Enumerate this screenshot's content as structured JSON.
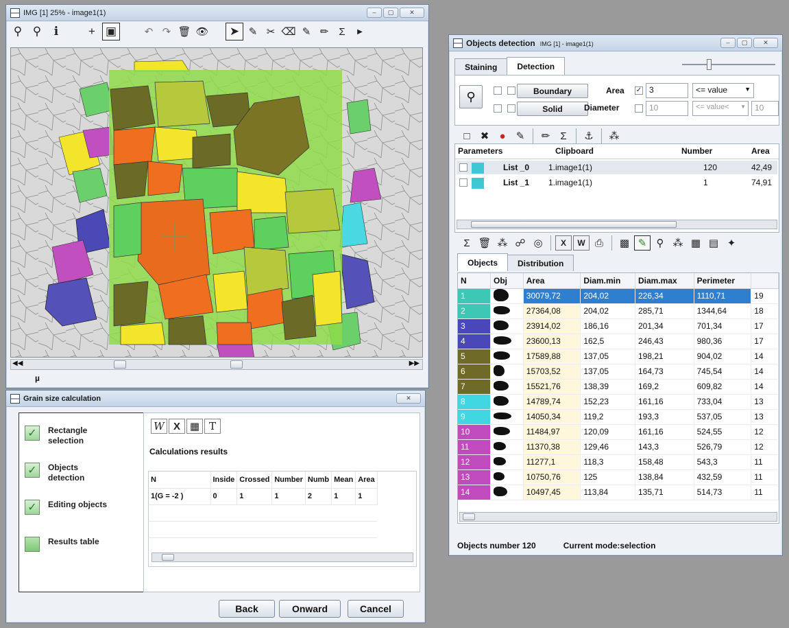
{
  "image_window": {
    "title": "IMG [1] 25% - image1(1)",
    "window_controls": [
      "–",
      "▢",
      "✕"
    ],
    "status_unit": "µ"
  },
  "grain_window": {
    "title": "Grain size calculation",
    "close": "✕",
    "steps": [
      {
        "label": "Rectangle selection",
        "done": true
      },
      {
        "label": "Objects detection",
        "done": true
      },
      {
        "label": "Editing objects",
        "done": true
      },
      {
        "label": "Results table",
        "done": false
      }
    ],
    "calc_title": "Calculations results",
    "table": {
      "headers": [
        "N",
        "Inside",
        "Crossed",
        "Number",
        "Numb",
        "Mean",
        "Area"
      ],
      "rows": [
        [
          "1(G = -2 )",
          "0",
          "1",
          "1",
          "2",
          "1",
          "1"
        ]
      ]
    },
    "buttons": {
      "back": "Back",
      "onward": "Onward",
      "cancel": "Cancel"
    }
  },
  "objects_window": {
    "title": "Objects detection",
    "title_sub": "IMG [1] - image1(1)",
    "tabs": [
      "Staining",
      "Detection"
    ],
    "detection": {
      "boundary_label": "Boundary",
      "solid_label": "Solid",
      "area_label": "Area",
      "area_value": "3",
      "area_mode": "<= value",
      "diameter_label": "Diameter",
      "diameter_value": "10",
      "diameter_mode": "<= value<",
      "diameter_value2": "10"
    },
    "list_headers": [
      "Parameters",
      "Clipboard",
      "Number",
      "Area"
    ],
    "list_rows": [
      {
        "name": "List _0",
        "clip": "1.image1(1)",
        "number": "120",
        "area": "42,49"
      },
      {
        "name": "List _1",
        "clip": "1.image1(1)",
        "number": "1",
        "area": "74,91"
      }
    ],
    "obj_tabs": [
      "Objects",
      "Distribution"
    ],
    "obj_headers": [
      "N",
      "Obj",
      "Area",
      "Diam.min",
      "Diam.max",
      "Perimeter",
      ""
    ],
    "obj_rows": [
      {
        "n": "1",
        "color": "#3dc7b5",
        "area": "30079,72",
        "dmin": "204,02",
        "dmax": "226,34",
        "per": "1110,71",
        "extra": "19"
      },
      {
        "n": "2",
        "color": "#3dc7b5",
        "area": "27364,08",
        "dmin": "204,02",
        "dmax": "285,71",
        "per": "1344,64",
        "extra": "18"
      },
      {
        "n": "3",
        "color": "#4a48b8",
        "area": "23914,02",
        "dmin": "186,16",
        "dmax": "201,34",
        "per": "701,34",
        "extra": "17"
      },
      {
        "n": "4",
        "color": "#4a48b8",
        "area": "23600,13",
        "dmin": "162,5",
        "dmax": "246,43",
        "per": "980,36",
        "extra": "17"
      },
      {
        "n": "5",
        "color": "#6f6a28",
        "area": "17589,88",
        "dmin": "137,05",
        "dmax": "198,21",
        "per": "904,02",
        "extra": "14"
      },
      {
        "n": "6",
        "color": "#6f6a28",
        "area": "15703,52",
        "dmin": "137,05",
        "dmax": "164,73",
        "per": "745,54",
        "extra": "14"
      },
      {
        "n": "7",
        "color": "#6f6a28",
        "area": "15521,76",
        "dmin": "138,39",
        "dmax": "169,2",
        "per": "609,82",
        "extra": "14"
      },
      {
        "n": "8",
        "color": "#40d6e2",
        "area": "14789,74",
        "dmin": "152,23",
        "dmax": "161,16",
        "per": "733,04",
        "extra": "13"
      },
      {
        "n": "9",
        "color": "#40d6e2",
        "area": "14050,34",
        "dmin": "119,2",
        "dmax": "193,3",
        "per": "537,05",
        "extra": "13"
      },
      {
        "n": "10",
        "color": "#c04bbd",
        "area": "11484,97",
        "dmin": "120,09",
        "dmax": "161,16",
        "per": "524,55",
        "extra": "12"
      },
      {
        "n": "11",
        "color": "#c04bbd",
        "area": "11370,38",
        "dmin": "129,46",
        "dmax": "143,3",
        "per": "526,79",
        "extra": "12"
      },
      {
        "n": "12",
        "color": "#c04bbd",
        "area": "11277,1",
        "dmin": "118,3",
        "dmax": "158,48",
        "per": "543,3",
        "extra": "11"
      },
      {
        "n": "13",
        "color": "#c04bbd",
        "area": "10750,76",
        "dmin": "125",
        "dmax": "138,84",
        "per": "432,59",
        "extra": "11"
      },
      {
        "n": "14",
        "color": "#c04bbd",
        "area": "10497,45",
        "dmin": "113,84",
        "dmax": "135,71",
        "per": "514,73",
        "extra": "11"
      }
    ],
    "status_left": "Objects number 120",
    "status_right": "Current mode:selection"
  }
}
